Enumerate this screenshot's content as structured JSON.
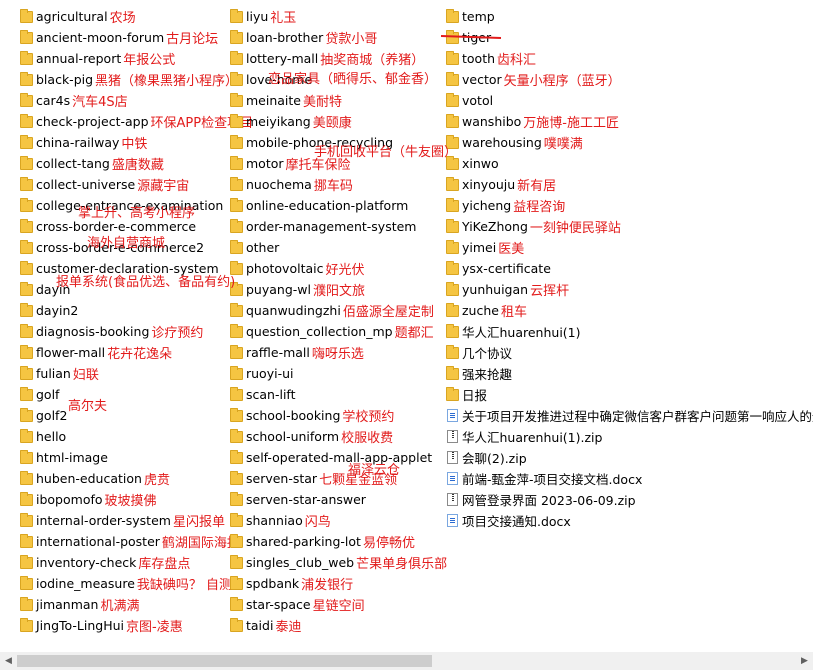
{
  "columns": [
    [
      {
        "name": "agricultural",
        "note": "农场",
        "icon": "folder-icon"
      },
      {
        "name": "ancient-moon-forum",
        "note": "古月论坛",
        "icon": "folder-icon"
      },
      {
        "name": "annual-report",
        "note": "年报公式",
        "icon": "folder-icon"
      },
      {
        "name": "black-pig",
        "note": "黑猪（橡果黑猪小程序）",
        "icon": "folder-icon"
      },
      {
        "name": "car4s",
        "note": "汽车4S店",
        "icon": "folder-icon"
      },
      {
        "name": "check-project-app",
        "note": "环保APP检查项目",
        "icon": "folder-icon"
      },
      {
        "name": "china-railway",
        "note": "中铁",
        "icon": "folder-icon"
      },
      {
        "name": "collect-tang",
        "note": "盛唐数藏",
        "icon": "folder-icon"
      },
      {
        "name": "collect-universe",
        "note": "源藏宇宙",
        "icon": "folder-icon"
      },
      {
        "name": "college-entrance-examination",
        "note": "",
        "icon": "folder-icon"
      },
      {
        "name": "cross-border-e-commerce",
        "note": "",
        "icon": "folder-icon"
      },
      {
        "name": "cross-border-e-commerce2",
        "note": "",
        "icon": "folder-icon"
      },
      {
        "name": "customer-declaration-system",
        "note": "",
        "icon": "folder-icon"
      },
      {
        "name": "dayin",
        "note": "",
        "icon": "folder-icon"
      },
      {
        "name": "dayin2",
        "note": "",
        "icon": "folder-icon"
      },
      {
        "name": "diagnosis-booking",
        "note": "诊疗预约",
        "icon": "folder-icon"
      },
      {
        "name": "flower-mall",
        "note": "花卉花逸朵",
        "icon": "folder-icon"
      },
      {
        "name": "fulian",
        "note": "妇联",
        "icon": "folder-icon"
      },
      {
        "name": "golf",
        "note": "",
        "icon": "folder-icon"
      },
      {
        "name": "golf2",
        "note": "",
        "icon": "folder-icon"
      },
      {
        "name": "hello",
        "note": "",
        "icon": "folder-icon"
      },
      {
        "name": "html-image",
        "note": "",
        "icon": "folder-icon"
      },
      {
        "name": "huben-education",
        "note": "虎贲",
        "icon": "folder-icon"
      },
      {
        "name": "ibopomofo",
        "note": "玻坡摸佛",
        "icon": "folder-icon"
      },
      {
        "name": "internal-order-system",
        "note": "星闪报单",
        "icon": "folder-icon"
      },
      {
        "name": "international-poster",
        "note": "鹤湖国际海报",
        "icon": "folder-icon"
      },
      {
        "name": "inventory-check",
        "note": "库存盘点",
        "icon": "folder-icon"
      },
      {
        "name": "iodine_measure",
        "note": "我缺碘吗？ 自测",
        "icon": "folder-icon"
      },
      {
        "name": "jimanman",
        "note": "机满满",
        "icon": "folder-icon"
      },
      {
        "name": "JingTo-LingHui",
        "note": "京图-凌惠",
        "icon": "folder-icon"
      }
    ],
    [
      {
        "name": "liyu",
        "note": "礼玉",
        "icon": "folder-icon"
      },
      {
        "name": "loan-brother",
        "note": "贷款小哥",
        "icon": "folder-icon"
      },
      {
        "name": "lottery-mall",
        "note": "抽奖商城（养猪）",
        "icon": "folder-icon"
      },
      {
        "name": "love-home",
        "note": "",
        "icon": "folder-icon"
      },
      {
        "name": "meinaite",
        "note": "美耐特",
        "icon": "folder-icon"
      },
      {
        "name": "meiyikang",
        "note": "美颐康",
        "icon": "folder-icon"
      },
      {
        "name": "mobile-phone-recycling",
        "note": "",
        "icon": "folder-icon"
      },
      {
        "name": "motor",
        "note": "摩托车保险",
        "icon": "folder-icon"
      },
      {
        "name": "nuochema",
        "note": "挪车码",
        "icon": "folder-icon"
      },
      {
        "name": "online-education-platform",
        "note": "",
        "icon": "folder-icon"
      },
      {
        "name": "order-management-system",
        "note": "",
        "icon": "folder-icon"
      },
      {
        "name": "other",
        "note": "",
        "icon": "folder-icon"
      },
      {
        "name": "photovoltaic",
        "note": "好光伏",
        "icon": "folder-icon"
      },
      {
        "name": "puyang-wl",
        "note": "濮阳文旅",
        "icon": "folder-icon"
      },
      {
        "name": "quanwudingzhi",
        "note": "佰盛源全屋定制",
        "icon": "folder-icon"
      },
      {
        "name": "question_collection_mp",
        "note": "题都汇",
        "icon": "folder-icon"
      },
      {
        "name": "raffle-mall",
        "note": "嗨呀乐选",
        "icon": "folder-icon"
      },
      {
        "name": "ruoyi-ui",
        "note": "",
        "icon": "folder-icon"
      },
      {
        "name": "scan-lift",
        "note": "",
        "icon": "folder-icon"
      },
      {
        "name": "school-booking",
        "note": "学校预约",
        "icon": "folder-icon"
      },
      {
        "name": "school-uniform",
        "note": "校服收费",
        "icon": "folder-icon"
      },
      {
        "name": "self-operated-mall-app-applet",
        "note": "",
        "icon": "folder-icon"
      },
      {
        "name": "serven-star",
        "note": "七颗星金蓝领",
        "icon": "folder-icon"
      },
      {
        "name": "serven-star-answer",
        "note": "",
        "icon": "folder-icon"
      },
      {
        "name": "shanniao",
        "note": "闪鸟",
        "icon": "folder-icon"
      },
      {
        "name": "shared-parking-lot",
        "note": "易停畅优",
        "icon": "folder-icon"
      },
      {
        "name": "singles_club_web",
        "note": "芒果单身俱乐部",
        "icon": "folder-icon"
      },
      {
        "name": "spdbank",
        "note": "浦发银行",
        "icon": "folder-icon"
      },
      {
        "name": "star-space",
        "note": "星链空间",
        "icon": "folder-icon"
      },
      {
        "name": "taidi",
        "note": "泰迪",
        "icon": "folder-icon"
      }
    ],
    [
      {
        "name": "temp",
        "note": "",
        "icon": "folder-icon"
      },
      {
        "name": "tiger",
        "note": "",
        "icon": "folder-icon"
      },
      {
        "name": "tooth",
        "note": "齿科汇",
        "icon": "folder-icon"
      },
      {
        "name": "vector",
        "note": "矢量小程序（蓝牙）",
        "icon": "folder-icon"
      },
      {
        "name": "votol",
        "note": "",
        "icon": "folder-icon"
      },
      {
        "name": "wanshibo",
        "note": "万施博-施工工匠",
        "icon": "folder-icon"
      },
      {
        "name": "warehousing",
        "note": "噗噗满",
        "icon": "folder-icon"
      },
      {
        "name": "xinwo",
        "note": "",
        "icon": "folder-icon"
      },
      {
        "name": "xinyouju",
        "note": "新有居",
        "icon": "folder-icon"
      },
      {
        "name": "yicheng",
        "note": "益程咨询",
        "icon": "folder-icon"
      },
      {
        "name": "YiKeZhong",
        "note": "一刻钟便民驿站",
        "icon": "folder-icon"
      },
      {
        "name": "yimei",
        "note": "医美",
        "icon": "folder-icon"
      },
      {
        "name": "ysx-certificate",
        "note": "",
        "icon": "folder-icon"
      },
      {
        "name": "yunhuigan",
        "note": "云挥杆",
        "icon": "folder-icon"
      },
      {
        "name": "zuche",
        "note": "租车",
        "icon": "folder-icon"
      },
      {
        "name": "华人汇huarenhui(1)",
        "note": "",
        "icon": "folder-icon"
      },
      {
        "name": "几个协议",
        "note": "",
        "icon": "folder-icon"
      },
      {
        "name": "强来抢趣",
        "note": "",
        "icon": "folder-icon"
      },
      {
        "name": "日报",
        "note": "",
        "icon": "folder-icon"
      },
      {
        "name": "关于项目开发推进过程中确定微信客户群客户问题第一响应人的通知.docx",
        "note": "",
        "icon": "word-file-icon"
      },
      {
        "name": "华人汇huarenhui(1).zip",
        "note": "",
        "icon": "zip-file-icon"
      },
      {
        "name": "会聊(2).zip",
        "note": "",
        "icon": "zip-file-icon"
      },
      {
        "name": "前端-甄金萍-项目交接文档.docx",
        "note": "",
        "icon": "word-file-icon"
      },
      {
        "name": "网管登录界面 2023-06-09.zip",
        "note": "",
        "icon": "zip-file-icon"
      },
      {
        "name": "项目交接通知.docx",
        "note": "",
        "icon": "word-file-icon"
      }
    ]
  ],
  "floating_notes": {
    "college": "掌上升、高考小程序",
    "cross_border": "海外自营商城",
    "customer_declaration": "报单系统(食品优选、备品有约)",
    "golf": "高尔夫",
    "love_home": "恋品家具（晒得乐、郁金香）",
    "mobile_phone": "手机回收平台（牛友圈）",
    "self_operated": "福泽云仓"
  },
  "accent_color": "#e21b1b"
}
